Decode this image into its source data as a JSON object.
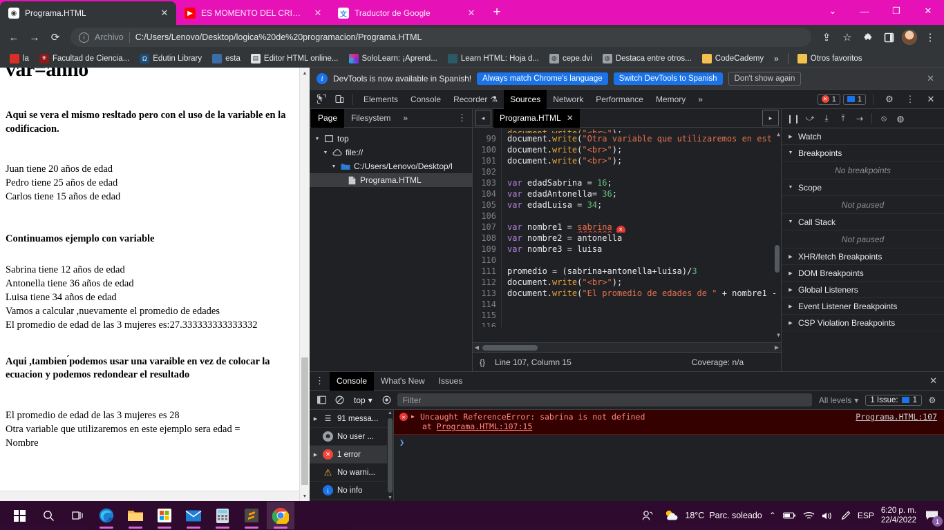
{
  "browser": {
    "tabs": [
      {
        "title": "Programa.HTML",
        "icon": "chrome-favicon",
        "active": true
      },
      {
        "title": "ES MOMENTO DEL CRINGE 😀 -",
        "icon": "youtube-favicon",
        "active": false
      },
      {
        "title": "Traductor de Google",
        "icon": "google-translate-favicon",
        "active": false
      }
    ],
    "new_tab_label": "+",
    "window_controls": {
      "more": "⌄",
      "minimize": "—",
      "maximize": "❐",
      "close": "✕"
    },
    "toolbar": {
      "back": "←",
      "forward": "→",
      "reload": "⟳",
      "scheme_label": "Archivo",
      "url": "C:/Users/Lenovo/Desktop/logica%20de%20programacion/Programa.HTML",
      "share": "⇪",
      "bookmark_star": "☆",
      "extensions": "🧩",
      "sidepanel": "▢",
      "menu": "⋮"
    },
    "bookmarks": [
      {
        "label": "la",
        "icon": "red-dot-icon"
      },
      {
        "label": "Facultad de Ciencia...",
        "icon": "crest-icon"
      },
      {
        "label": "Edutin Library",
        "icon": "edutin-icon"
      },
      {
        "label": "esta",
        "icon": "blue-square-icon"
      },
      {
        "label": "Editor HTML online...",
        "icon": "document-icon"
      },
      {
        "label": "SoloLearn: ¡Aprend...",
        "icon": "sololearn-icon"
      },
      {
        "label": "Learn HTML: Hoja d...",
        "icon": "teal-square-icon"
      },
      {
        "label": "cepe.dvi",
        "icon": "globe-icon"
      },
      {
        "label": "Destaca entre otros...",
        "icon": "globe-icon"
      },
      {
        "label": "CodeCademy",
        "icon": "folder-icon"
      }
    ],
    "bookmarks_overflow": "»",
    "other_bookmarks": {
      "label": "Otros favoritos",
      "icon": "folder-icon"
    }
  },
  "page": {
    "heading": "var=anno",
    "bold1": "Aqui se vera el mismo resltado pero con el uso de la variable en la codificacion.",
    "lines1": [
      "Juan tiene 20 años de edad",
      "Pedro tiene 25 años de edad",
      "Carlos tiene 15 años de edad"
    ],
    "bold2": "Continuamos ejemplo con variable",
    "lines2": [
      "Sabrina tiene 12 años de edad",
      "Antonella tiene 36 años de edad",
      "Luisa tiene 34 años de edad",
      "Vamos a calcular ,nuevamente el promedio de edades",
      "El promedio de edad de las 3 mujeres es:27.333333333333332"
    ],
    "bold3": "Aqui ,tambien ́podemos usar una varaible en vez de colocar la ecuacion y podemos redondear el resultado",
    "lines3": [
      "El promedio de edad de las 3 mujeres es 28",
      "Otra variable que utilizaremos en este ejemplo sera edad =",
      "Nombre"
    ]
  },
  "devtools": {
    "banner": {
      "message": "DevTools is now available in Spanish!",
      "primary_button": "Always match Chrome's language",
      "secondary_button": "Switch DevTools to Spanish",
      "dismiss_button": "Don't show again",
      "close": "✕"
    },
    "tabs": [
      {
        "label": "Elements",
        "active": false
      },
      {
        "label": "Console",
        "active": false
      },
      {
        "label": "Recorder",
        "active": false,
        "suffix": "⚗"
      },
      {
        "label": "Sources",
        "active": true
      },
      {
        "label": "Network",
        "active": false
      },
      {
        "label": "Performance",
        "active": false
      },
      {
        "label": "Memory",
        "active": false
      }
    ],
    "tabs_overflow": "»",
    "error_badge": "1",
    "message_badge": "1",
    "settings": "⚙",
    "kebab": "⋮",
    "close": "✕",
    "navigator": {
      "tabs": [
        {
          "label": "Page",
          "active": true
        },
        {
          "label": "Filesystem",
          "active": false
        }
      ],
      "overflow": "»",
      "kebab": "⋮",
      "tree": [
        {
          "label": "top",
          "icon": "frame-icon",
          "depth": 0
        },
        {
          "label": "file://",
          "icon": "cloud-icon",
          "depth": 1
        },
        {
          "label": "C:/Users/Lenovo/Desktop/l",
          "icon": "folder-icon",
          "depth": 2
        },
        {
          "label": "Programa.HTML",
          "icon": "file-icon",
          "depth": 3,
          "selected": true
        }
      ]
    },
    "editor": {
      "tab_label": "Programa.HTML",
      "tab_close": "✕",
      "prev_button": "◂",
      "next_button": "▸",
      "first_visible_line": 99,
      "lines": [
        {
          "n": 99,
          "code": "document.write(\"Otra variable que utilizaremos en est"
        },
        {
          "n": 100,
          "code": "document.write(\"<br>\");"
        },
        {
          "n": 101,
          "code": "document.write(\"<br>\");"
        },
        {
          "n": 102,
          "code": ""
        },
        {
          "n": 103,
          "code": "var edadSabrina = 16;"
        },
        {
          "n": 104,
          "code": "var edadAntonella= 36;"
        },
        {
          "n": 105,
          "code": "var edadLuisa = 34;"
        },
        {
          "n": 106,
          "code": ""
        },
        {
          "n": 107,
          "code": "var nombre1 = sabrina"
        },
        {
          "n": 108,
          "code": "var nombre2 = antonella"
        },
        {
          "n": 109,
          "code": "var nombre3 = luisa"
        },
        {
          "n": 110,
          "code": ""
        },
        {
          "n": 111,
          "code": "promedio = (sabrina+antonella+luisa)/3"
        },
        {
          "n": 112,
          "code": "document.write(\"<br>\");"
        },
        {
          "n": 113,
          "code": "document.write(\"El promedio de edades de \" + nombre1 -"
        },
        {
          "n": 114,
          "code": ""
        },
        {
          "n": 115,
          "code": ""
        },
        {
          "n": 116,
          "code": ""
        }
      ],
      "status_cursor": "Line 107, Column 15",
      "status_coverage": "Coverage: n/a",
      "status_braces": "{}"
    },
    "debugger": {
      "toolbar": [
        "pause-icon",
        "step-over-icon",
        "step-into-icon",
        "step-out-icon",
        "step-icon",
        "deactivate-breakpoints-icon",
        "pause-on-exceptions-icon"
      ],
      "sections": [
        {
          "label": "Watch",
          "expanded": false,
          "empty": null
        },
        {
          "label": "Breakpoints",
          "expanded": true,
          "empty": "No breakpoints"
        },
        {
          "label": "Scope",
          "expanded": true,
          "empty": "Not paused"
        },
        {
          "label": "Call Stack",
          "expanded": true,
          "empty": "Not paused"
        },
        {
          "label": "XHR/fetch Breakpoints",
          "expanded": false,
          "empty": null
        },
        {
          "label": "DOM Breakpoints",
          "expanded": false,
          "empty": null
        },
        {
          "label": "Global Listeners",
          "expanded": false,
          "empty": null
        },
        {
          "label": "Event Listener Breakpoints",
          "expanded": false,
          "empty": null
        },
        {
          "label": "CSP Violation Breakpoints",
          "expanded": false,
          "empty": null
        }
      ]
    },
    "drawer": {
      "kebab": "⋮",
      "tabs": [
        {
          "label": "Console",
          "active": true
        },
        {
          "label": "What's New",
          "active": false
        },
        {
          "label": "Issues",
          "active": false
        }
      ],
      "close": "✕",
      "console_toolbar": {
        "sidebar_toggle": "◱",
        "clear": "🚫",
        "context": "top",
        "context_caret": "▾",
        "eye": "◉",
        "filter_placeholder": "Filter",
        "levels": "All levels",
        "levels_caret": "▾",
        "issues_label": "1 Issue:",
        "issues_count": "1",
        "settings": "⚙"
      },
      "sidebar": [
        {
          "label": "91 messa...",
          "icon": "list-icon",
          "expandable": true,
          "selected": false
        },
        {
          "label": "No user ...",
          "icon": "user-icon",
          "expandable": false,
          "selected": false
        },
        {
          "label": "1 error",
          "icon": "error-icon",
          "expandable": true,
          "selected": true
        },
        {
          "label": "No warni...",
          "icon": "warning-icon",
          "expandable": false,
          "selected": false
        },
        {
          "label": "No info",
          "icon": "info-icon",
          "expandable": false,
          "selected": false
        }
      ],
      "error": {
        "title": "Uncaught ReferenceError: sabrina is not defined",
        "stack": "at Programa.HTML:107:15",
        "stack_prefix": "at ",
        "stack_link": "Programa.HTML:107:15",
        "source_link": "Programa.HTML:107"
      },
      "prompt": "❯"
    }
  },
  "taskbar": {
    "items": [
      {
        "name": "start-button",
        "icon": "windows-logo"
      },
      {
        "name": "search-button",
        "icon": "search-icon"
      },
      {
        "name": "task-view-button",
        "icon": "task-view-icon"
      },
      {
        "name": "edge-button",
        "icon": "edge-icon"
      },
      {
        "name": "file-explorer-button",
        "icon": "folder-icon"
      },
      {
        "name": "microsoft-store-button",
        "icon": "store-icon"
      },
      {
        "name": "mail-button",
        "icon": "mail-icon"
      },
      {
        "name": "calculator-button",
        "icon": "calculator-icon"
      },
      {
        "name": "sublime-text-button",
        "icon": "sublime-icon"
      },
      {
        "name": "chrome-button",
        "icon": "chrome-icon"
      }
    ],
    "people_icon": "people-icon",
    "weather_temp": "18°C",
    "weather_desc": "Parc. soleado",
    "tray": {
      "chevron": "⌃",
      "battery": "🔋",
      "wifi": "📶",
      "volume": "🔊",
      "pen": "🖊",
      "language": "ESP"
    },
    "time": "6:20 p. m.",
    "date": "22/4/2022",
    "notification_count": "1"
  },
  "colors": {
    "tabstrip_pink": "#e612b8",
    "chrome_dark": "#323639",
    "devtools_bg": "#202124",
    "accent_blue": "#1a73e8",
    "error_red": "#f44336",
    "taskbar": "#300a30"
  }
}
